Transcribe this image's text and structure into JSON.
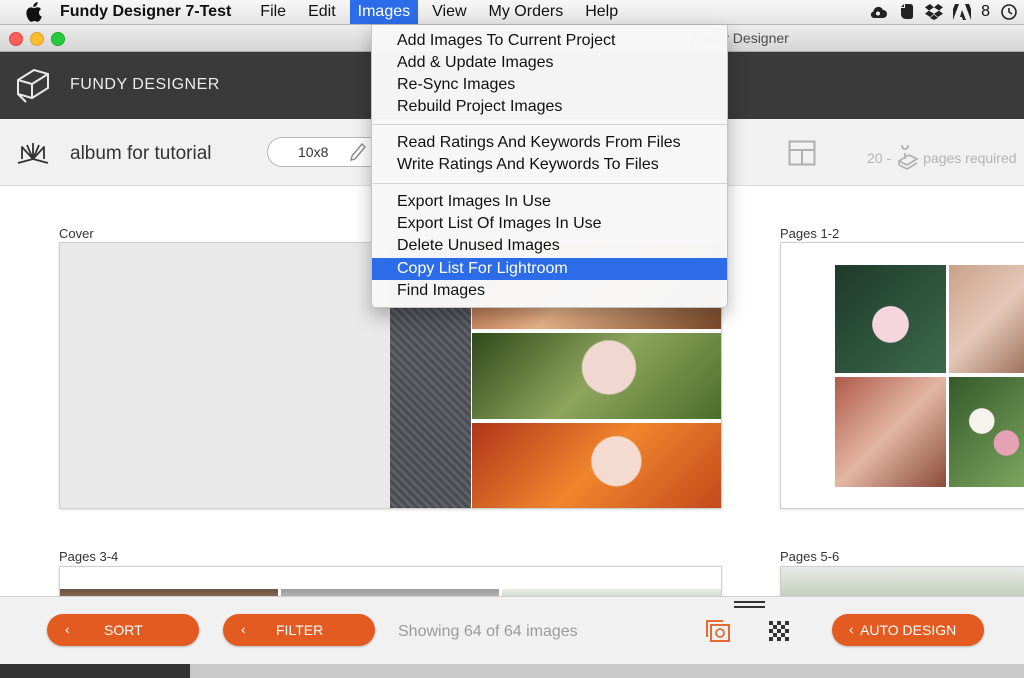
{
  "menubar": {
    "app_name": "Fundy Designer 7-Test",
    "items": [
      "File",
      "Edit",
      "Images",
      "View",
      "My Orders",
      "Help"
    ],
    "active_item": "Images",
    "tray_text": "8",
    "tray_icons": [
      "apple-icon",
      "creative-cloud-icon",
      "evernote-icon",
      "dropbox-icon",
      "adobe-icon",
      "time-machine-icon"
    ]
  },
  "window": {
    "title": "Fundy Designer"
  },
  "header": {
    "brand": "FUNDY DESIGNER"
  },
  "project": {
    "title": "album for tutorial",
    "size": "10x8",
    "pages_count": "20 -",
    "pages_label": "pages required"
  },
  "images_menu": {
    "groups": [
      [
        "Add Images To Current Project",
        "Add & Update Images",
        "Re-Sync Images",
        "Rebuild Project Images"
      ],
      [
        "Read Ratings And Keywords From Files",
        "Write Ratings And Keywords To Files"
      ],
      [
        "Export Images In Use",
        "Export List Of Images In Use",
        "Delete Unused Images",
        "Copy List For Lightroom",
        "Find Images"
      ]
    ],
    "highlighted": "Copy List For Lightroom"
  },
  "spreads": {
    "cover": "Cover",
    "pages_1_2": "Pages 1-2",
    "pages_3_4": "Pages 3-4",
    "pages_5_6": "Pages 5-6"
  },
  "toolbar": {
    "sort_label": "SORT",
    "filter_label": "FILTER",
    "showing_text": "Showing 64 of 64 images",
    "auto_design_label": "AUTO DESIGN"
  },
  "colors": {
    "accent_orange": "#e35b20",
    "menu_highlight": "#2c6ce8",
    "header_dark": "#3a3a3a"
  }
}
